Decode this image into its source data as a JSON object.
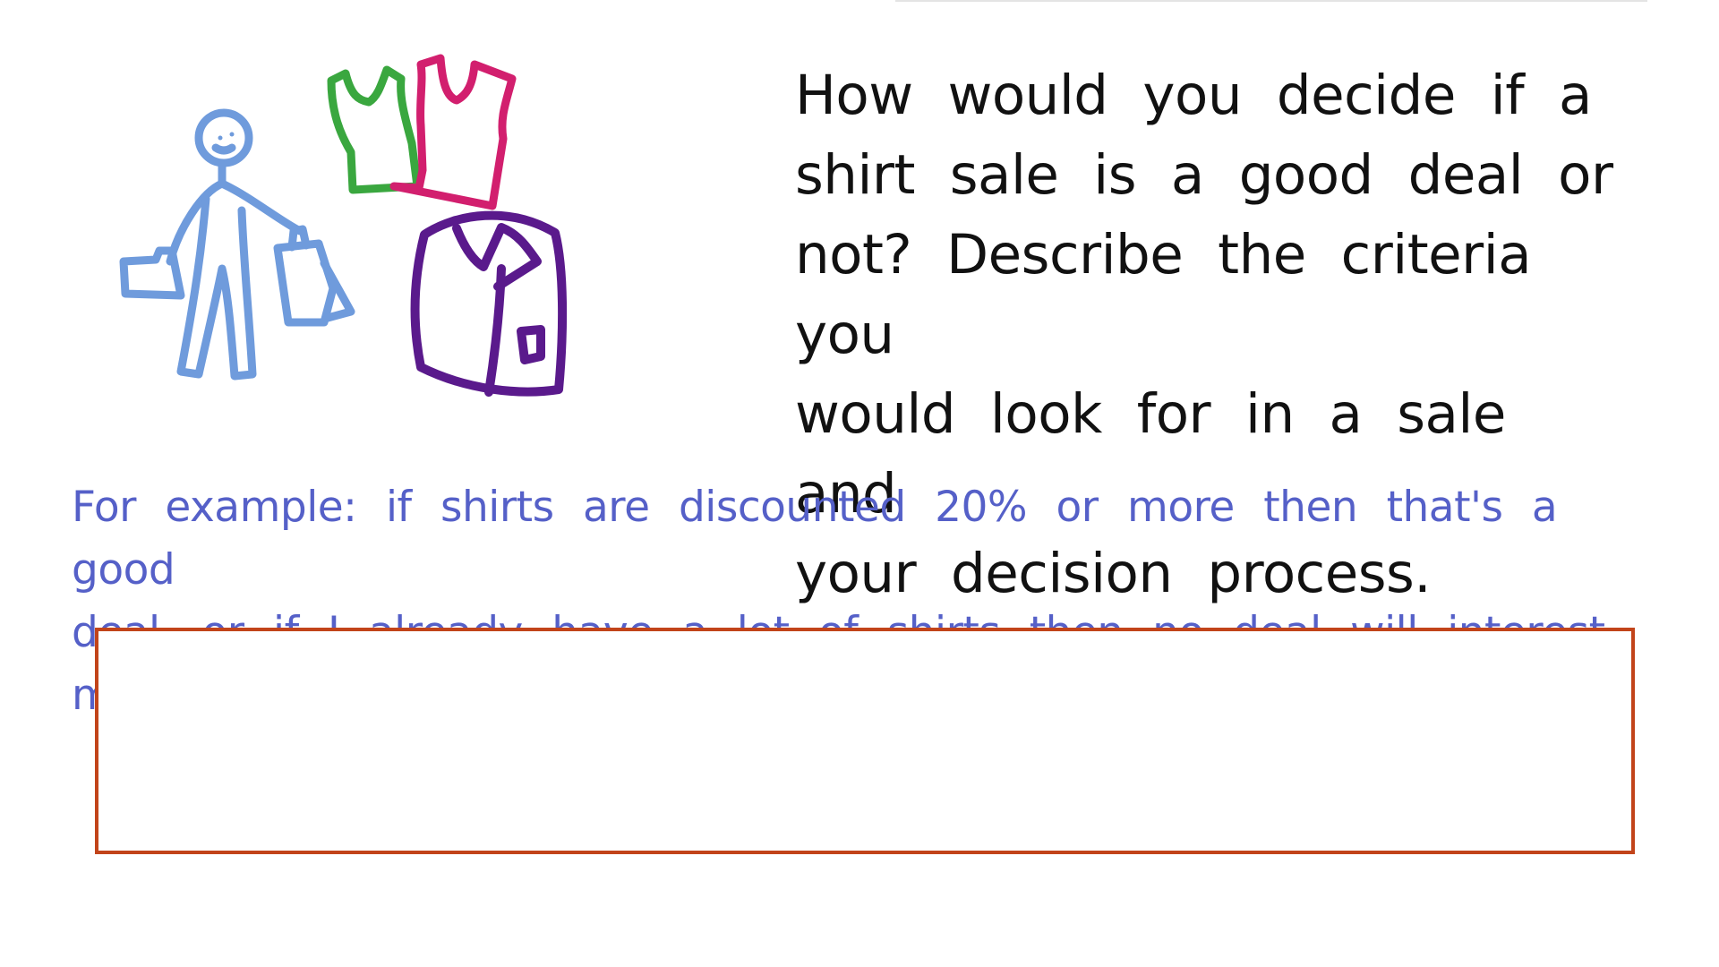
{
  "question": {
    "line1": "How would you decide if a",
    "line2": "shirt sale is a good deal or",
    "line3": "not? Describe the criteria you",
    "line4": "would look for in a sale and",
    "line5": "your decision process."
  },
  "example": {
    "line1": "For example: if shirts are discounted 20% or more then that's a good",
    "line2": "deal, or if I already have a lot of shirts then no deal will interest me, etc."
  },
  "answer": {
    "value": ""
  },
  "colors": {
    "question_text": "#111111",
    "example_text": "#5560c8",
    "answer_border": "#c2441a",
    "person": "#6f9bdc",
    "green_shirt": "#3aa73f",
    "pink_shirt": "#d21f6e",
    "purple_shirt": "#5a1a8c"
  },
  "icons": [
    "shopper-icon",
    "green-tank-top-icon",
    "pink-tank-top-icon",
    "folded-shirt-icon"
  ]
}
